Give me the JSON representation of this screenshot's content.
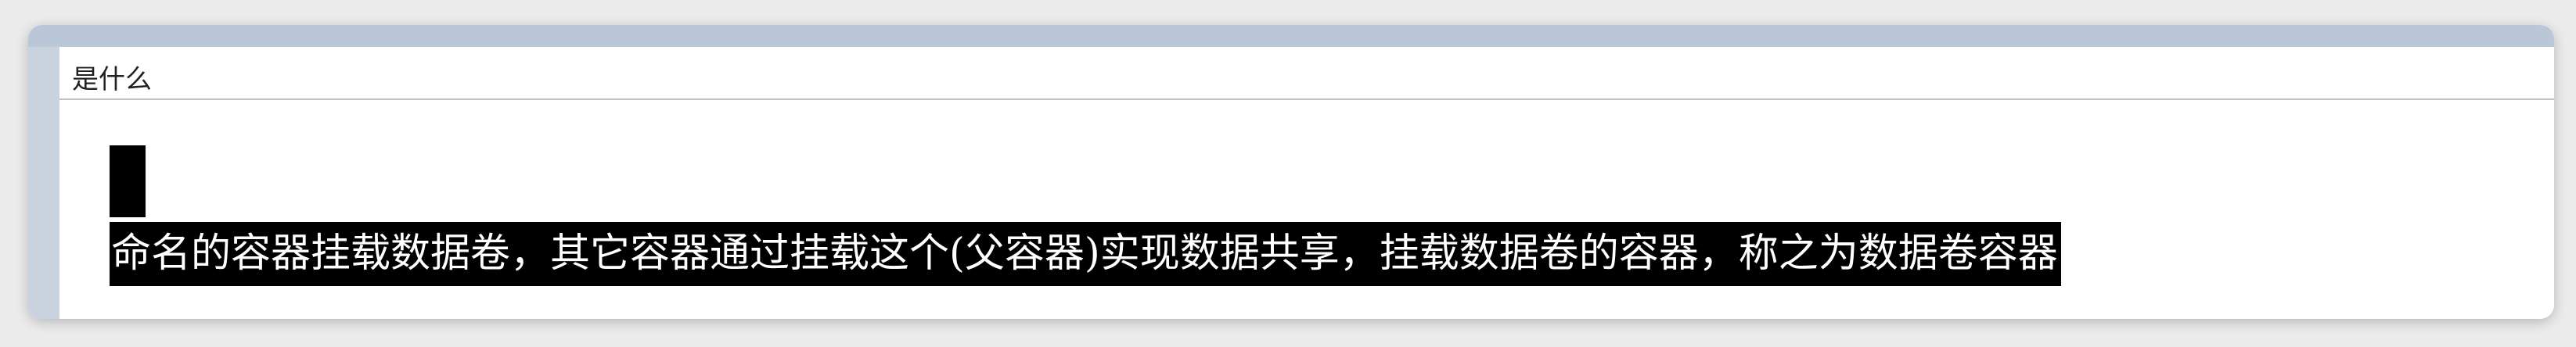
{
  "document": {
    "heading": "是什么",
    "selected_text": "命名的容器挂载数据卷，其它容器通过挂载这个(父容器)实现数据共享，挂载数据卷的容器，称之为数据卷容器"
  },
  "colors": {
    "selection_background": "#000000",
    "selection_text": "#ffffff",
    "window_top_strip": "#b9c7d8",
    "left_gutter": "#c9d3df"
  }
}
